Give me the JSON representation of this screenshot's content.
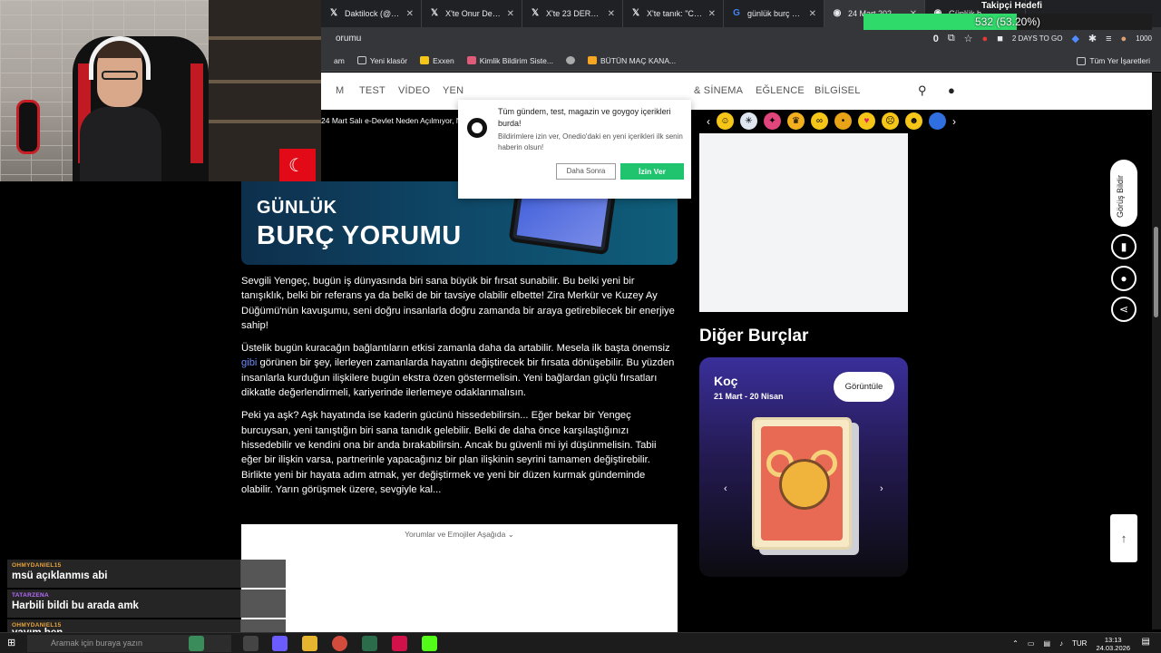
{
  "browser": {
    "tabs": [
      {
        "label": "Daktilock (@dakt",
        "icon": "x-logo-icon"
      },
      {
        "label": "X'te Onur Derçin",
        "icon": "x-logo-icon"
      },
      {
        "label": "X'te 23 DERECE: '",
        "icon": "x-logo-icon"
      },
      {
        "label": "X'te tanık: \"Cem Y",
        "icon": "x-logo-icon"
      },
      {
        "label": "günlük burç yoru",
        "icon": "google-icon"
      },
      {
        "label": "24 Mart 2026 Gü",
        "icon": "onedio-icon",
        "active": true
      },
      {
        "label": "Günlük b",
        "icon": "onedio-icon"
      }
    ],
    "address_fragment": "orumu",
    "bookmarks": [
      {
        "label": "am",
        "icon": "bookmark-icon"
      },
      {
        "label": "Yeni klasör",
        "icon": "folder-icon"
      },
      {
        "label": "Exxen",
        "icon": "exxen-icon"
      },
      {
        "label": "Kimlik Bildirim Siste...",
        "icon": "kimlik-icon"
      },
      {
        "label": "",
        "icon": "globe-icon"
      },
      {
        "label": "BÜTÜN MAÇ KANA...",
        "icon": "jp-icon"
      }
    ],
    "all_bookmarks": "Tüm Yer İşaretleri",
    "toolbar_counter": "0",
    "days_to_go": "2 DAYS TO GO",
    "count_badge": "1000"
  },
  "site_nav": {
    "items": [
      "M",
      "TEST",
      "VİDEO",
      "YEN",
      "& SİNEMA",
      "EĞLENCE",
      "BİLGİSEL"
    ],
    "search_icon": "search-icon",
    "user_icon": "user-icon"
  },
  "ticker": {
    "text": "24 Mart Salı e-Devlet Neden Açılmıyor, N"
  },
  "hero": {
    "line1": "GÜNLÜK",
    "line2": "BURÇ YORUMU"
  },
  "article": {
    "p1": "Sevgili Yengeç, bugün iş dünyasında biri sana büyük bir fırsat sunabilir. Bu belki yeni bir tanışıklık, belki bir referans ya da belki de bir tavsiye olabilir elbette! Zira Merkür ve Kuzey Ay Düğümü'nün kavuşumu, seni doğru insanlarla doğru zamanda bir araya getirebilecek bir enerjiye sahip!",
    "p2_a": "Üstelik bugün kuracağın bağlantıların etkisi zamanla daha da artabilir. Mesela ilk başta önemsiz",
    "p2_link": "gibi",
    "p2_b": " görünen bir şey, ilerleyen zamanlarda hayatını değiştirecek bir fırsata dönüşebilir. Bu yüzden insanlarla kurduğun ilişkilere bugün ekstra özen göstermelisin. Yeni bağlardan güçlü fırsatları dikkatle değerlendirmeli, kariyerinde ilerlemeye odaklanmalısın.",
    "p3": "Peki ya aşk? Aşk hayatında ise kaderin gücünü hissedebilirsin... Eğer bekar bir Yengeç burcuysan, yeni tanıştığın biri sana tanıdık gelebilir. Belki de daha önce karşılaştığınızı hissedebilir ve kendini ona bir anda bırakabilirsin. Ancak bu güvenli mi iyi düşünmelisin. Tabii eğer bir ilişkin varsa, partnerinle yapacağınız bir plan ilişkinin seyrini tamamen değiştirebilir. Birlikte yeni bir hayata adım atmak, yer değiştirmek ve yeni bir düzen kurmak gündeminde olabilir. Yarın görüşmek üzere, sevgiyle kal..."
  },
  "comments": {
    "title": "Yorumlar ve Emojiler Aşağıda ⌄"
  },
  "emojis": [
    {
      "icon": "smile-emoji-icon",
      "color": "#f5c518"
    },
    {
      "icon": "snowflake-emoji-icon",
      "color": "#dfe6f0"
    },
    {
      "icon": "party-emoji-icon",
      "color": "#e0457b"
    },
    {
      "icon": "crown-emoji-icon",
      "color": "#f2b01e"
    },
    {
      "icon": "glasses-emoji-icon",
      "color": "#f5c518"
    },
    {
      "icon": "neutral-emoji-icon",
      "color": "#e8a317"
    },
    {
      "icon": "heart-eyes-emoji-icon",
      "color": "#f5c518"
    },
    {
      "icon": "sad-emoji-icon",
      "color": "#f5c518"
    },
    {
      "icon": "laugh-emoji-icon",
      "color": "#f5c518"
    },
    {
      "icon": "blue-badge-emoji-icon",
      "color": "#2f6fe0"
    }
  ],
  "other_signs": {
    "title": "Diğer Burçlar",
    "sign": "Koç",
    "dates": "21 Mart - 20 Nisan",
    "view_button": "Görüntüle"
  },
  "floating": {
    "feedback": "Görüş Bildir"
  },
  "notification": {
    "title": "Tüm gündem, test, magazin ve goygoy içerikleri burda!",
    "body": "Bildirimlere izin ver, Onedio'daki en yeni içerikleri ilk senin haberin olsun!",
    "later": "Daha Sonra",
    "allow": "İzin Ver"
  },
  "stream_goal": {
    "label": "Takipçi Hedefi",
    "text": "532 (53.20%)",
    "progress": 0.532
  },
  "chat": [
    {
      "user": "OHMYDANIEL15",
      "text": "msü açıklanmıs abi",
      "color": "#e8a33c"
    },
    {
      "user": "TATARZENA",
      "text": "Harbili bildi bu arada amk",
      "color": "#b86cff"
    },
    {
      "user": "OHMYDANIEL15",
      "text": "yayım ben",
      "color": "#e8a33c"
    }
  ],
  "taskbar": {
    "search_placeholder": "Aramak için buraya yazın",
    "lang": "TUR",
    "time": "13:13",
    "date": "24.03.2026"
  }
}
